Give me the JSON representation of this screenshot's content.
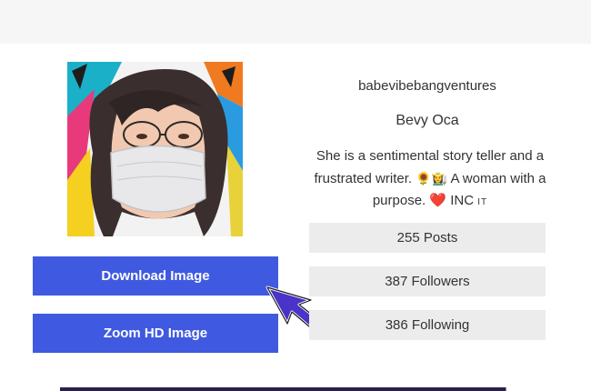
{
  "profile": {
    "username": "babevibebangventures",
    "full_name": "Bevy Oca",
    "bio": {
      "line1": "She is a sentimental story teller and a",
      "line2_text": "frustrated writer.",
      "line2_emoji1": "🌻",
      "line2_emoji2": "👩‍🌾",
      "line2_end": "A woman with a",
      "line3_text": "purpose.",
      "line3_heart": "❤️",
      "line3_end": "INC",
      "line3_small": "IT"
    }
  },
  "stats": {
    "posts": "255 Posts",
    "followers": "387 Followers",
    "following": "386 Following"
  },
  "actions": {
    "download_label": "Download Image",
    "zoom_label": "Zoom HD Image"
  },
  "colors": {
    "primary_button": "#3f5ae0",
    "stat_background": "#ececec",
    "top_bar": "#f6f6f7",
    "cursor": "#4a33c8"
  },
  "icons": {
    "cursor": "pointer-cursor-icon",
    "avatar": "profile-avatar-image"
  }
}
